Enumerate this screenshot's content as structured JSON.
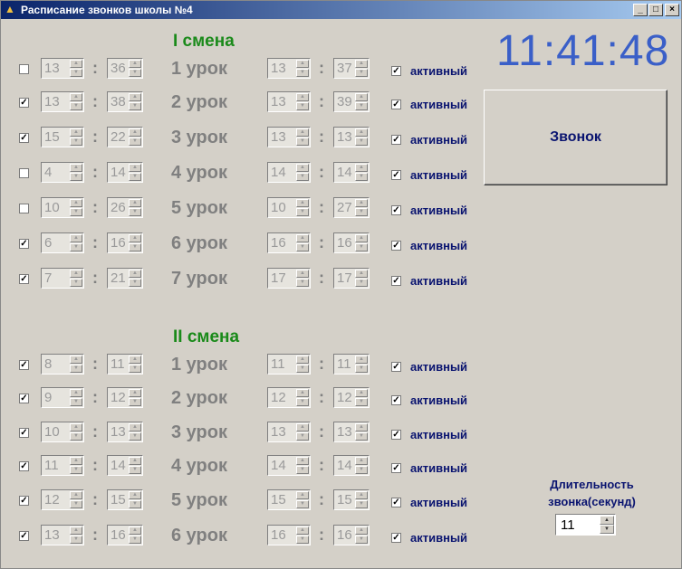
{
  "window": {
    "title": "Расписание звонков школы №4",
    "minimize": "_",
    "maximize": "□",
    "close": "×"
  },
  "clock": "11:41:48",
  "bell_button": "Звонок",
  "duration": {
    "label_line1": "Длительность",
    "label_line2": "звонка(секунд)",
    "value": "11"
  },
  "active_label": "активный",
  "shift1": {
    "title": "I смена",
    "lessons": [
      {
        "checked": false,
        "sh": "13",
        "sm": "36",
        "label": "1 урок",
        "eh": "13",
        "em": "37",
        "active": true
      },
      {
        "checked": true,
        "sh": "13",
        "sm": "38",
        "label": "2 урок",
        "eh": "13",
        "em": "39",
        "active": true
      },
      {
        "checked": true,
        "sh": "15",
        "sm": "22",
        "label": "3 урок",
        "eh": "13",
        "em": "13",
        "active": true
      },
      {
        "checked": false,
        "sh": "4",
        "sm": "14",
        "label": "4 урок",
        "eh": "14",
        "em": "14",
        "active": true
      },
      {
        "checked": false,
        "sh": "10",
        "sm": "26",
        "label": "5 урок",
        "eh": "10",
        "em": "27",
        "active": true
      },
      {
        "checked": true,
        "sh": "6",
        "sm": "16",
        "label": "6 урок",
        "eh": "16",
        "em": "16",
        "active": true
      },
      {
        "checked": true,
        "sh": "7",
        "sm": "21",
        "label": "7 урок",
        "eh": "17",
        "em": "17",
        "active": true
      }
    ]
  },
  "shift2": {
    "title": "II смена",
    "lessons": [
      {
        "checked": true,
        "sh": "8",
        "sm": "11",
        "label": "1 урок",
        "eh": "11",
        "em": "11",
        "active": true
      },
      {
        "checked": true,
        "sh": "9",
        "sm": "12",
        "label": "2 урок",
        "eh": "12",
        "em": "12",
        "active": true
      },
      {
        "checked": true,
        "sh": "10",
        "sm": "13",
        "label": "3 урок",
        "eh": "13",
        "em": "13",
        "active": true
      },
      {
        "checked": true,
        "sh": "11",
        "sm": "14",
        "label": "4 урок",
        "eh": "14",
        "em": "14",
        "active": true
      },
      {
        "checked": true,
        "sh": "12",
        "sm": "15",
        "label": "5 урок",
        "eh": "15",
        "em": "15",
        "active": true
      },
      {
        "checked": true,
        "sh": "13",
        "sm": "16",
        "label": "6 урок",
        "eh": "16",
        "em": "16",
        "active": true
      }
    ]
  }
}
